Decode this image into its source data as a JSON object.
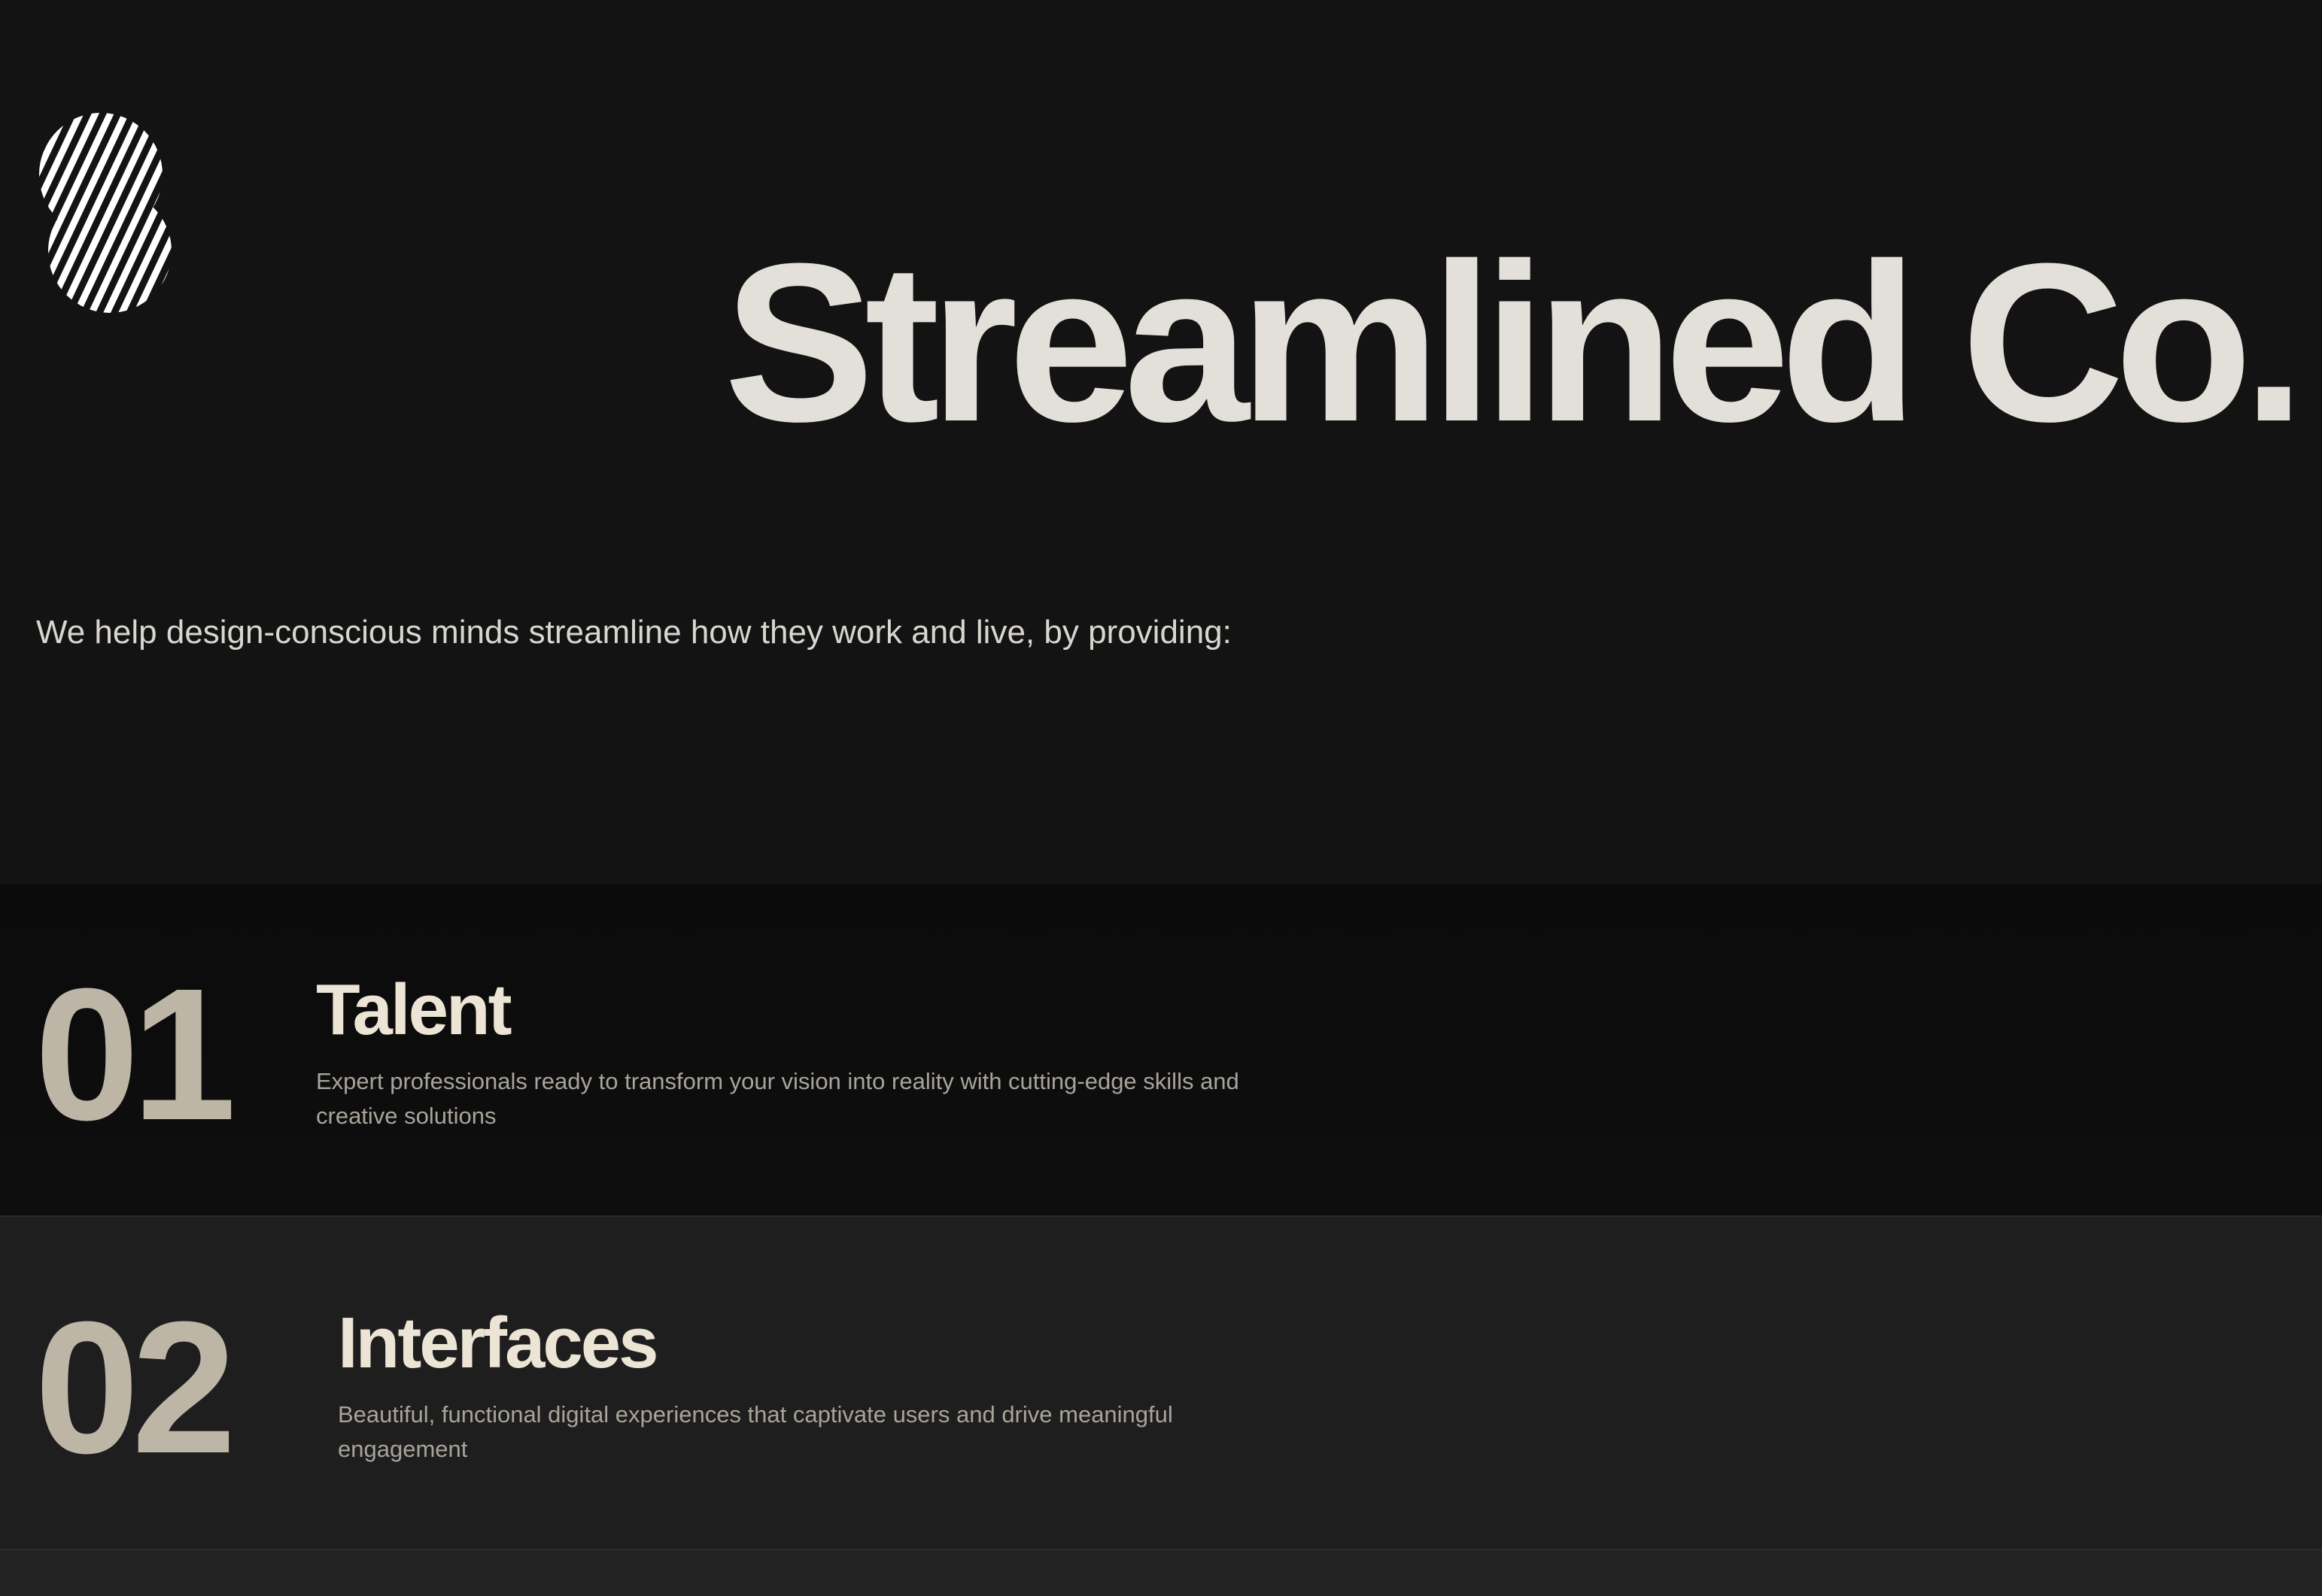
{
  "brand": {
    "logo_icon": "striped-s-logo-icon",
    "title": "Streamlined Co."
  },
  "hero": {
    "tagline": "We help design-conscious minds streamline how they work and live, by providing:"
  },
  "services": [
    {
      "number": "01",
      "title": "Talent",
      "description": "Expert professionals ready to transform your vision into reality with cutting-edge skills and creative solutions"
    },
    {
      "number": "02",
      "title": "Interfaces",
      "description": "Beautiful, functional digital experiences that captivate users and drive meaningful engagement"
    }
  ],
  "colors": {
    "background": "#131313",
    "section_dark": "#0b0b0b",
    "section_mid": "#1e1e1e",
    "heading_text": "#e3e0da",
    "number_text": "#bdb6a6",
    "service_title_text": "#ece4d4",
    "body_text": "#a9a49b"
  }
}
